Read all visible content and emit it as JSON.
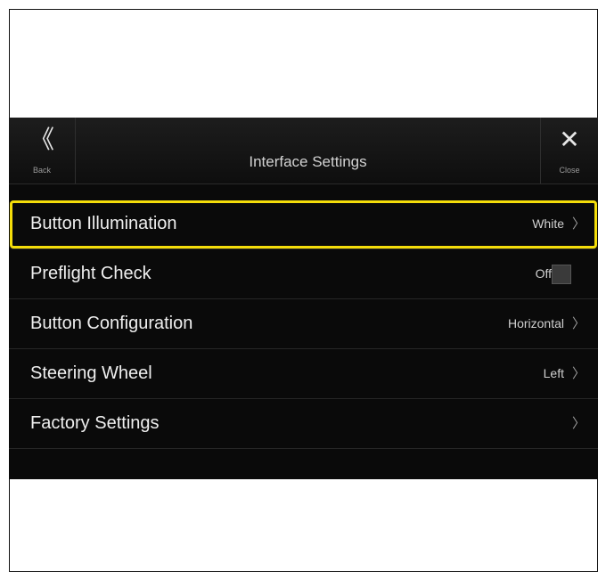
{
  "header": {
    "back_glyph": "《",
    "back_label": "Back",
    "title": "Interface Settings",
    "close_glyph": "✕",
    "close_label": "Close"
  },
  "settings": [
    {
      "label": "Button Illumination",
      "value": "White",
      "chevron": "〉",
      "selected": true
    },
    {
      "label": "Preflight Check",
      "value": "Off",
      "toggle": "off"
    },
    {
      "label": "Button Configuration",
      "value": "Horizontal",
      "chevron": "〉"
    },
    {
      "label": "Steering Wheel",
      "value": "Left",
      "chevron": "〉"
    },
    {
      "label": "Factory Settings",
      "value": "",
      "chevron": "〉"
    }
  ],
  "colors": {
    "highlight": "#f4dd0a",
    "background": "#0a0a0a"
  }
}
